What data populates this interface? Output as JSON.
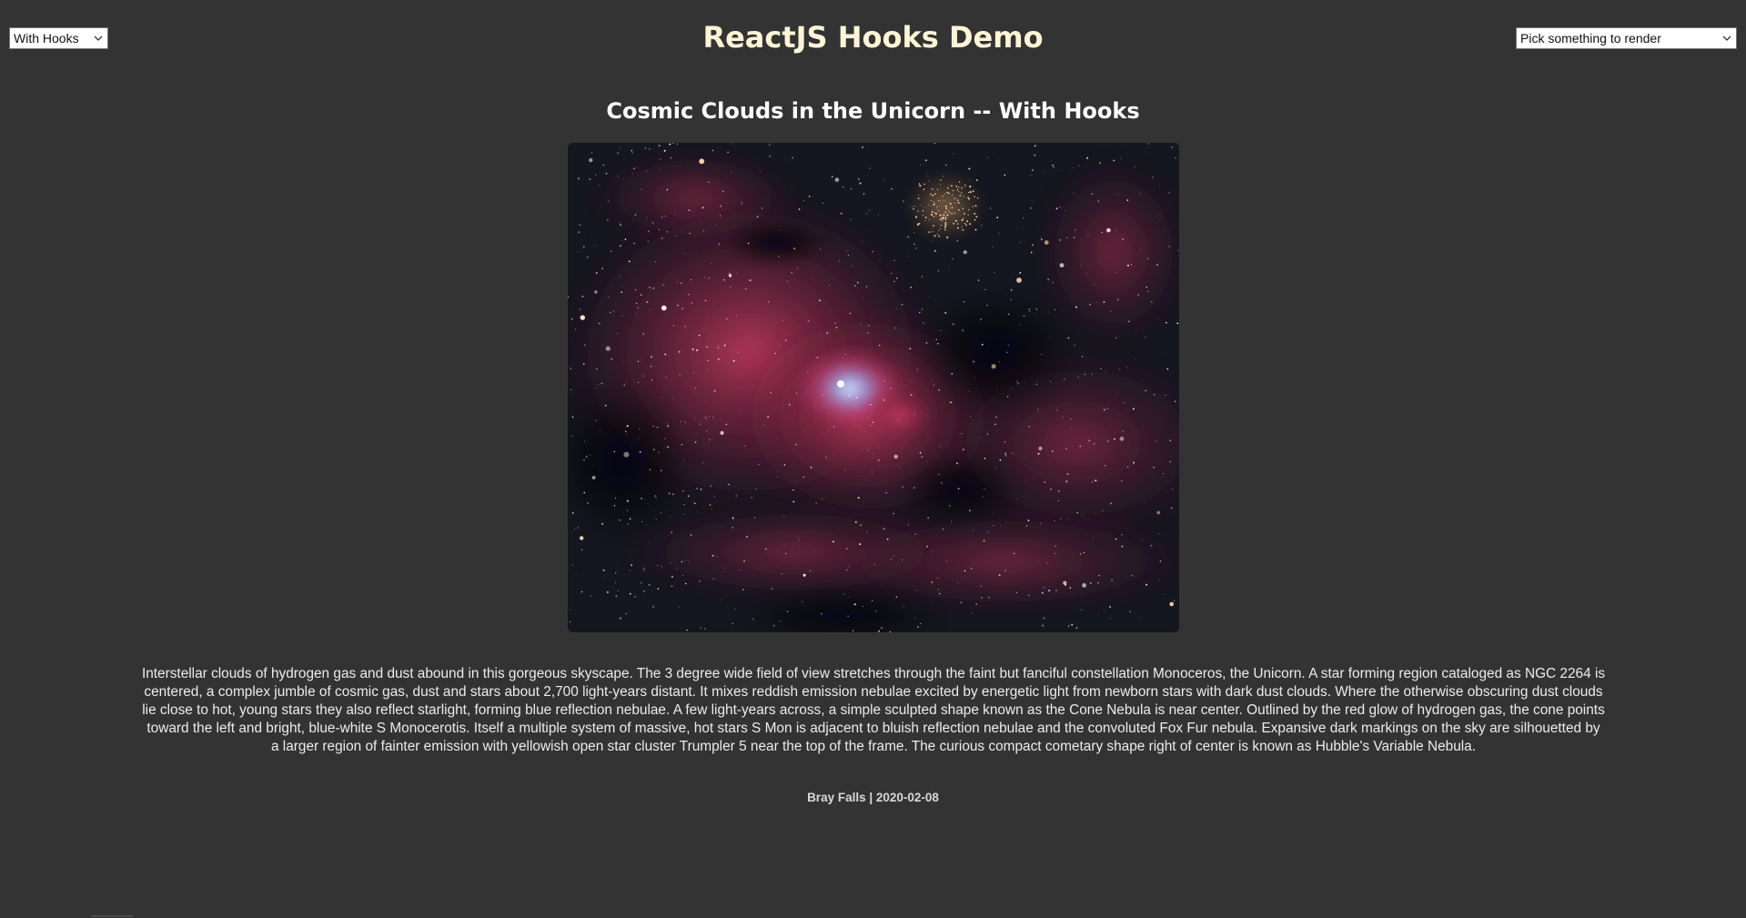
{
  "header": {
    "title": "ReactJS Hooks Demo",
    "mode_select": {
      "selected": "With Hooks"
    },
    "render_select": {
      "selected": "Pick something to render"
    }
  },
  "apod": {
    "title": "Cosmic Clouds in the Unicorn -- With Hooks",
    "image_alt": "Cosmic Clouds in the Unicorn",
    "explanation": "Interstellar clouds of hydrogen gas and dust abound in this gorgeous skyscape. The 3 degree wide field of view stretches through the faint but fanciful constellation Monoceros, the Unicorn. A star forming region cataloged as NGC 2264 is centered, a complex jumble of cosmic gas, dust and stars about 2,700 light-years distant. It mixes reddish emission nebulae excited by energetic light from newborn stars with dark dust clouds. Where the otherwise obscuring dust clouds lie close to hot, young stars they also reflect starlight, forming blue reflection nebulae. A few light-years across, a simple sculpted shape known as the Cone Nebula is near center. Outlined by the red glow of hydrogen gas, the cone points toward the left and bright, blue-white S Monocerotis. Itself a multiple system of massive, hot stars S Mon is adjacent to bluish reflection nebulae and the convoluted Fox Fur nebula. Expansive dark markings on the sky are silhouetted by a larger region of fainter emission with yellowish open star cluster Trumpler 5 near the top of the frame. The curious compact cometary shape right of center is known as Hubble's Variable Nebula.",
    "credit": "Bray Falls | 2020-02-08"
  },
  "colors": {
    "background": "#333333",
    "app_title": "#fff5d6",
    "nebula_red": "#c8345a",
    "reflection_blue": "#a9c4ff"
  },
  "icons": {
    "dropdown": "chevron-down-icon"
  }
}
